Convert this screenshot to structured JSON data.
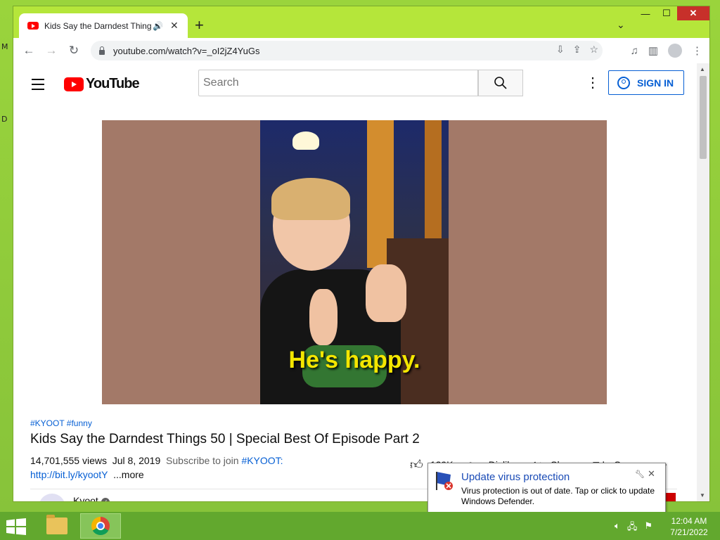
{
  "desktop": {
    "letter_m": "M",
    "letter_d": "D"
  },
  "browser": {
    "tab": {
      "title": "Kids Say the Darndest Things 50 | Special Best Of Episode Part 2",
      "close": "✕"
    },
    "new_tab": "+",
    "tab_search": "⌄",
    "window_controls": {
      "minimize": "—",
      "maximize": "☐",
      "close": "✕"
    },
    "address": {
      "url": "youtube.com/watch?v=_oI2jZ4YuGs"
    }
  },
  "youtube": {
    "logo_text": "YouTube",
    "search_placeholder": "Search",
    "sign_in": "SIGN IN",
    "caption": "He's happy.",
    "hashtags": "#KYOOT #funny",
    "title": "Kids Say the Darndest Things 50 | Special Best Of Episode Part 2",
    "views": "14,701,555 views",
    "date": "Jul 8, 2019",
    "desc_prefix": "Subscribe to join",
    "desc_tag": "#KYOOT:",
    "desc_link": "http://bit.ly/kyootY",
    "more": "...more",
    "actions": {
      "likes": "129K",
      "dislike": "Dislike",
      "share": "Share",
      "save": "Save",
      "more": "•••"
    },
    "channel": {
      "name": "Kyoot"
    }
  },
  "notification": {
    "title": "Update virus protection",
    "body": "Virus protection is out of date. Tap or click to update Windows Defender."
  },
  "taskbar": {
    "time": "12:04 AM",
    "date": "7/21/2022"
  },
  "colors": {
    "desktop": "#8cc83c",
    "brand_red": "#ff0000",
    "link_blue": "#065fd4",
    "toast_title": "#1a4bb6"
  }
}
